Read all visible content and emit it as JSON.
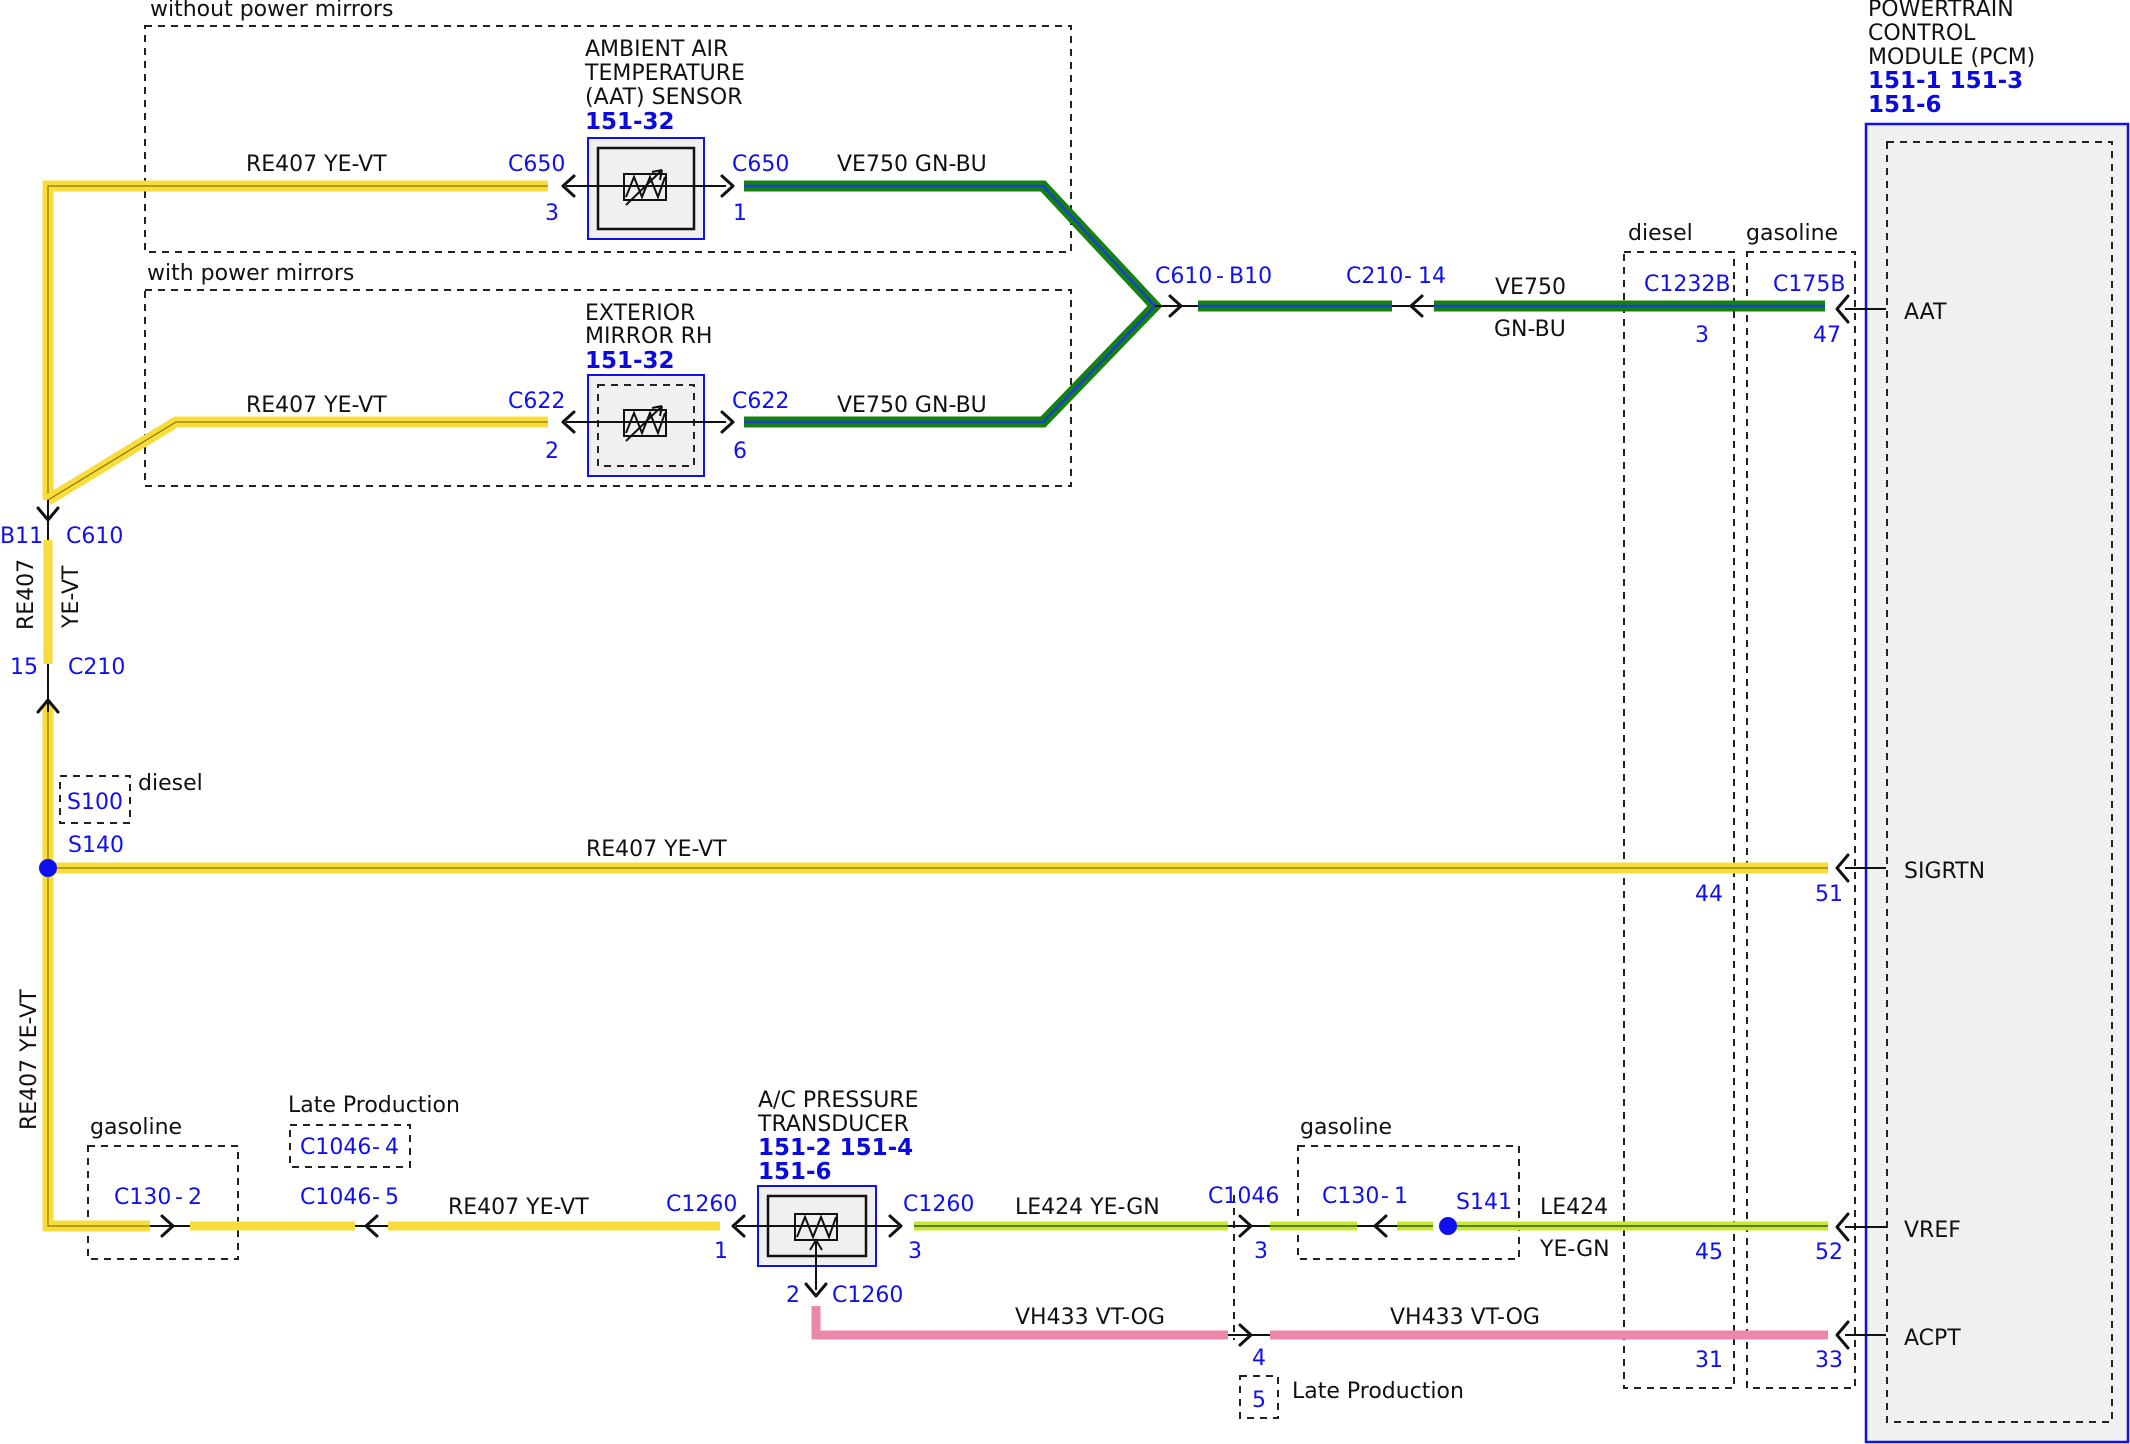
{
  "colors": {
    "yellow": "#f7dc3c",
    "yellow_green": "#c8e632",
    "green": "#15820f",
    "blue_stripe": "#1b3fd6",
    "pink": "#ec87ac",
    "label_blue": "#1010ee",
    "pcm_fill": "#f0f0f0"
  },
  "groups": {
    "without_mirrors": "without power mirrors",
    "with_mirrors": "with power mirrors",
    "diesel": "diesel",
    "gasoline": "gasoline",
    "diesel_s100": "diesel",
    "gasoline_c130": "gasoline",
    "gasoline_s141": "gasoline",
    "late_production": "Late Production",
    "late_production_2": "Late Production"
  },
  "components": {
    "aat_sensor": {
      "name_lines": [
        "AMBIENT AIR",
        "TEMPERATURE",
        "(AAT) SENSOR"
      ],
      "ref": "151-32"
    },
    "mirror": {
      "name_lines": [
        "EXTERIOR",
        "MIRROR RH"
      ],
      "ref": "151-32"
    },
    "ac_transducer": {
      "name_lines": [
        "A/C PRESSURE",
        "TRANSDUCER"
      ],
      "ref_lines": [
        "151-2 151-4",
        "151-6"
      ]
    },
    "pcm": {
      "name_lines": [
        "POWERTRAIN",
        "CONTROL",
        "MODULE (PCM)"
      ],
      "ref_lines": [
        "151-1 151-3",
        "151-6"
      ]
    }
  },
  "pins": {
    "aat": "AAT",
    "sigrtn": "SIGRTN",
    "vref": "VREF",
    "acpt": "ACPT"
  },
  "labels": {
    "c650_left": "C650",
    "c650_left_pin": "3",
    "c650_right": "C650",
    "c650_right_pin": "1",
    "c622_left": "C622",
    "c622_left_pin": "2",
    "c622_right": "C622",
    "c622_right_pin": "6",
    "c610_b10_a": "C610",
    "c610_b10_dash": "-",
    "c610_b10_b": "B10",
    "c210_14_a": "C210",
    "c210_14_dash": "-",
    "c210_14_b": "14",
    "c1232b": "C1232B",
    "c1232b_pin_aat": "3",
    "c175b": "C175B",
    "c175b_pin_aat": "47",
    "b11": "B11",
    "c610": "C610",
    "pin15": "15",
    "c210": "C210",
    "s100": "S100",
    "s140": "S140",
    "pin44": "44",
    "pin51": "51",
    "c130_2_a": "C130",
    "c130_2_dash": "-",
    "c130_2_b": "2",
    "c1046_4_a": "C1046",
    "c1046_4_dash": "-",
    "c1046_4_b": "4",
    "c1046_5_a": "C1046",
    "c1046_5_dash": "-",
    "c1046_5_b": "5",
    "c1260_left": "C1260",
    "c1260_left_pin": "1",
    "c1260_right": "C1260",
    "c1260_right_pin": "3",
    "c1260_bottom": "C1260",
    "c1260_bottom_pin": "2",
    "c1046_top": "C1046",
    "c1046_pin3": "3",
    "c1046_pin4": "4",
    "c130_1_a": "C130",
    "c130_1_dash": "-",
    "c130_1_b": "1",
    "s141": "S141",
    "pin45": "45",
    "pin52": "52",
    "pin31": "31",
    "pin33": "33",
    "late_box_pin": "5"
  },
  "wires": {
    "re407_ye_vt_top": "RE407  YE-VT",
    "re407_ye_vt_mirror": "RE407  YE-VT",
    "ve750_gn_bu_top": "VE750  GN-BU",
    "ve750_gn_bu_mirror": "VE750  GN-BU",
    "ve750_code": "VE750",
    "ve750_color": "GN-BU",
    "re407_vert_code": "RE407",
    "re407_vert_color": "YE-VT",
    "re407_sig": "RE407   YE-VT",
    "re407_lower_vert": "RE407   YE-VT",
    "re407_bottom": "RE407    YE-VT",
    "le424_left": "LE424    YE-GN",
    "le424_code": "LE424",
    "le424_color": "YE-GN",
    "vh433_left": "VH433   VT-OG",
    "vh433_right": "VH433   VT-OG"
  }
}
